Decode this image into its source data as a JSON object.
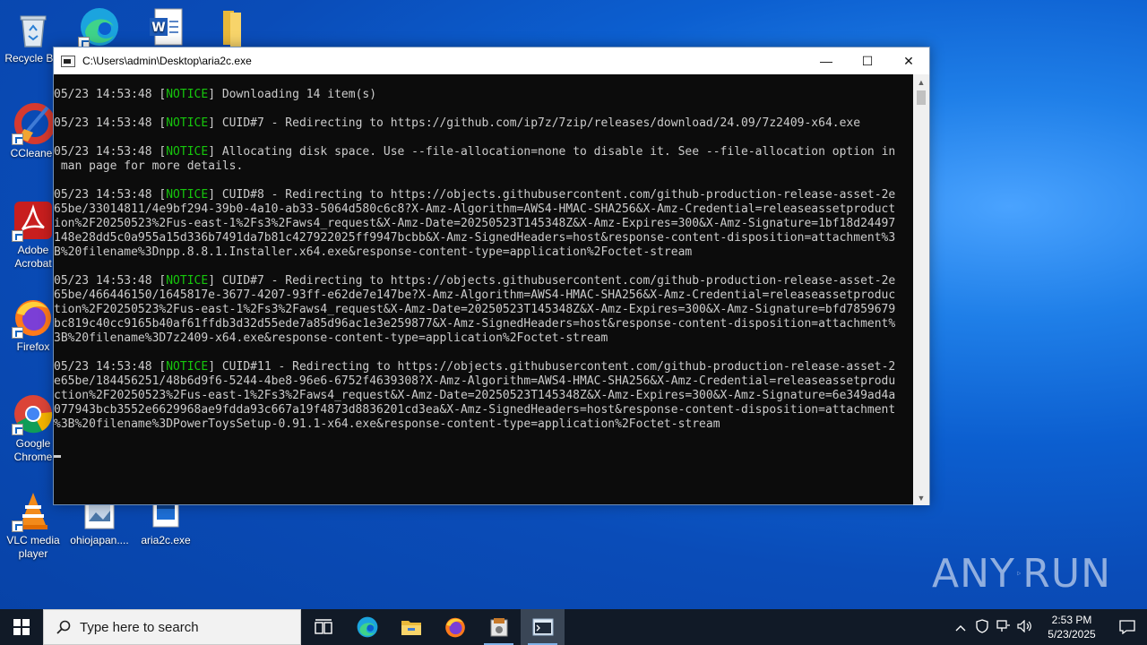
{
  "desktop": {
    "icons": [
      {
        "label": "Recycle Bin",
        "glyph": "recycle-bin-icon"
      },
      {
        "label": "",
        "glyph": "edge-icon"
      },
      {
        "label": "",
        "glyph": "word-doc-icon"
      },
      {
        "label": "",
        "glyph": "folder-icon"
      },
      {
        "label": "CCleaner",
        "glyph": "ccleaner-icon"
      },
      {
        "label": "Adobe Acrobat",
        "glyph": "acrobat-icon"
      },
      {
        "label": "Firefox",
        "glyph": "firefox-icon"
      },
      {
        "label": "Google Chrome",
        "glyph": "chrome-icon"
      },
      {
        "label": "VLC media player",
        "glyph": "vlc-icon"
      },
      {
        "label": "ohiojapan....",
        "glyph": "image-file-icon"
      },
      {
        "label": "aria2c.exe",
        "glyph": "exe-file-icon"
      }
    ]
  },
  "window": {
    "title": "C:\\Users\\admin\\Desktop\\aria2c.exe",
    "controls": {
      "minimize": "—",
      "maximize": "☐",
      "close": "✕"
    }
  },
  "console": {
    "lines": [
      {
        "prefix": "05/23 14:53:48 [",
        "tag": "NOTICE",
        "text": "] Downloading 14 item(s)"
      },
      {
        "prefix": "",
        "tag": "",
        "text": ""
      },
      {
        "prefix": "05/23 14:53:48 [",
        "tag": "NOTICE",
        "text": "] CUID#7 - Redirecting to https://github.com/ip7z/7zip/releases/download/24.09/7z2409-x64.exe"
      },
      {
        "prefix": "",
        "tag": "",
        "text": ""
      },
      {
        "prefix": "05/23 14:53:48 [",
        "tag": "NOTICE",
        "text": "] Allocating disk space. Use --file-allocation=none to disable it. See --file-allocation option in"
      },
      {
        "prefix": "",
        "tag": "",
        "text": " man page for more details."
      },
      {
        "prefix": "",
        "tag": "",
        "text": ""
      },
      {
        "prefix": "05/23 14:53:48 [",
        "tag": "NOTICE",
        "text": "] CUID#8 - Redirecting to https://objects.githubusercontent.com/github-production-release-asset-2e"
      },
      {
        "prefix": "",
        "tag": "",
        "text": "65be/33014811/4e9bf294-39b0-4a10-ab33-5064d580c6c8?X-Amz-Algorithm=AWS4-HMAC-SHA256&X-Amz-Credential=releaseassetproduct"
      },
      {
        "prefix": "",
        "tag": "",
        "text": "ion%2F20250523%2Fus-east-1%2Fs3%2Faws4_request&X-Amz-Date=20250523T145348Z&X-Amz-Expires=300&X-Amz-Signature=1bf18d24497"
      },
      {
        "prefix": "",
        "tag": "",
        "text": "148e28dd5c0a955a15d336b7491da7b81c427922025ff9947bcbb&X-Amz-SignedHeaders=host&response-content-disposition=attachment%3"
      },
      {
        "prefix": "",
        "tag": "",
        "text": "B%20filename%3Dnpp.8.8.1.Installer.x64.exe&response-content-type=application%2Foctet-stream"
      },
      {
        "prefix": "",
        "tag": "",
        "text": ""
      },
      {
        "prefix": "05/23 14:53:48 [",
        "tag": "NOTICE",
        "text": "] CUID#7 - Redirecting to https://objects.githubusercontent.com/github-production-release-asset-2e"
      },
      {
        "prefix": "",
        "tag": "",
        "text": "65be/466446150/1645817e-3677-4207-93ff-e62de7e147be?X-Amz-Algorithm=AWS4-HMAC-SHA256&X-Amz-Credential=releaseassetproduc"
      },
      {
        "prefix": "",
        "tag": "",
        "text": "tion%2F20250523%2Fus-east-1%2Fs3%2Faws4_request&X-Amz-Date=20250523T145348Z&X-Amz-Expires=300&X-Amz-Signature=bfd7859679"
      },
      {
        "prefix": "",
        "tag": "",
        "text": "bc819c40cc9165b40af61ffdb3d32d55ede7a85d96ac1e3e259877&X-Amz-SignedHeaders=host&response-content-disposition=attachment%"
      },
      {
        "prefix": "",
        "tag": "",
        "text": "3B%20filename%3D7z2409-x64.exe&response-content-type=application%2Foctet-stream"
      },
      {
        "prefix": "",
        "tag": "",
        "text": ""
      },
      {
        "prefix": "05/23 14:53:48 [",
        "tag": "NOTICE",
        "text": "] CUID#11 - Redirecting to https://objects.githubusercontent.com/github-production-release-asset-2"
      },
      {
        "prefix": "",
        "tag": "",
        "text": "e65be/184456251/48b6d9f6-5244-4be8-96e6-6752f4639308?X-Amz-Algorithm=AWS4-HMAC-SHA256&X-Amz-Credential=releaseassetprodu"
      },
      {
        "prefix": "",
        "tag": "",
        "text": "ction%2F20250523%2Fus-east-1%2Fs3%2Faws4_request&X-Amz-Date=20250523T145348Z&X-Amz-Expires=300&X-Amz-Signature=6e349ad4a"
      },
      {
        "prefix": "",
        "tag": "",
        "text": "077943bcb3552e6629968ae9fdda93c667a19f4873d8836201cd3ea&X-Amz-SignedHeaders=host&response-content-disposition=attachment"
      },
      {
        "prefix": "",
        "tag": "",
        "text": "%3B%20filename%3DPowerToysSetup-0.91.1-x64.exe&response-content-type=application%2Foctet-stream"
      }
    ]
  },
  "watermark": {
    "left": "ANY",
    "right": "RUN"
  },
  "taskbar": {
    "search_placeholder": "Type here to search",
    "apps": [
      "task-view-icon",
      "edge-icon",
      "file-explorer-icon",
      "firefox-icon",
      "installer-icon",
      "console-icon"
    ],
    "clock_time": "2:53 PM",
    "clock_date": "5/23/2025"
  },
  "colors": {
    "notice": "#16c60c",
    "console_bg": "#0c0c0c",
    "console_text": "#cccccc",
    "taskbar_bg": "#111a27"
  }
}
